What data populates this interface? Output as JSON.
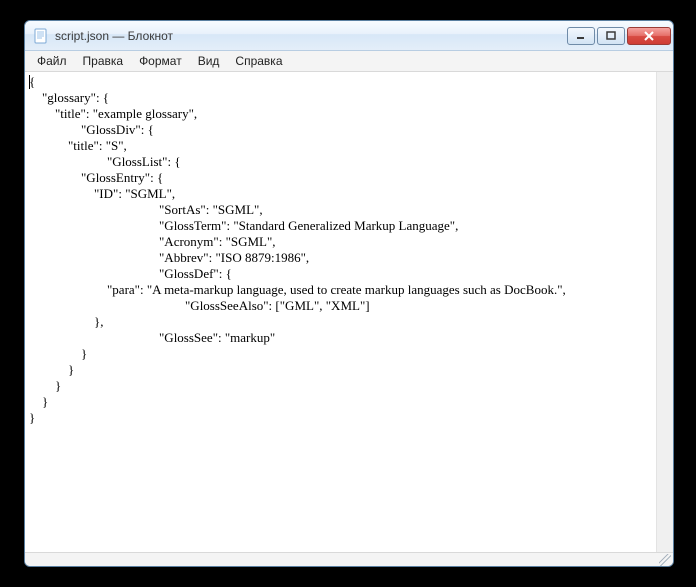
{
  "window": {
    "title": "script.json — Блокнот"
  },
  "menu": {
    "file": "Файл",
    "edit": "Правка",
    "format": "Формат",
    "view": "Вид",
    "help": "Справка"
  },
  "editor": {
    "content": "{\n    \"glossary\": {\n        \"title\": \"example glossary\",\n\t\t\"GlossDiv\": {\n            \"title\": \"S\",\n\t\t\t\"GlossList\": {\n                \"GlossEntry\": {\n                    \"ID\": \"SGML\",\n\t\t\t\t\t\"SortAs\": \"SGML\",\n\t\t\t\t\t\"GlossTerm\": \"Standard Generalized Markup Language\",\n\t\t\t\t\t\"Acronym\": \"SGML\",\n\t\t\t\t\t\"Abbrev\": \"ISO 8879:1986\",\n\t\t\t\t\t\"GlossDef\": {\n                        \"para\": \"A meta-markup language, used to create markup languages such as DocBook.\",\n\t\t\t\t\t\t\"GlossSeeAlso\": [\"GML\", \"XML\"]\n                    },\n\t\t\t\t\t\"GlossSee\": \"markup\"\n                }\n            }\n        }\n    }\n}"
  }
}
